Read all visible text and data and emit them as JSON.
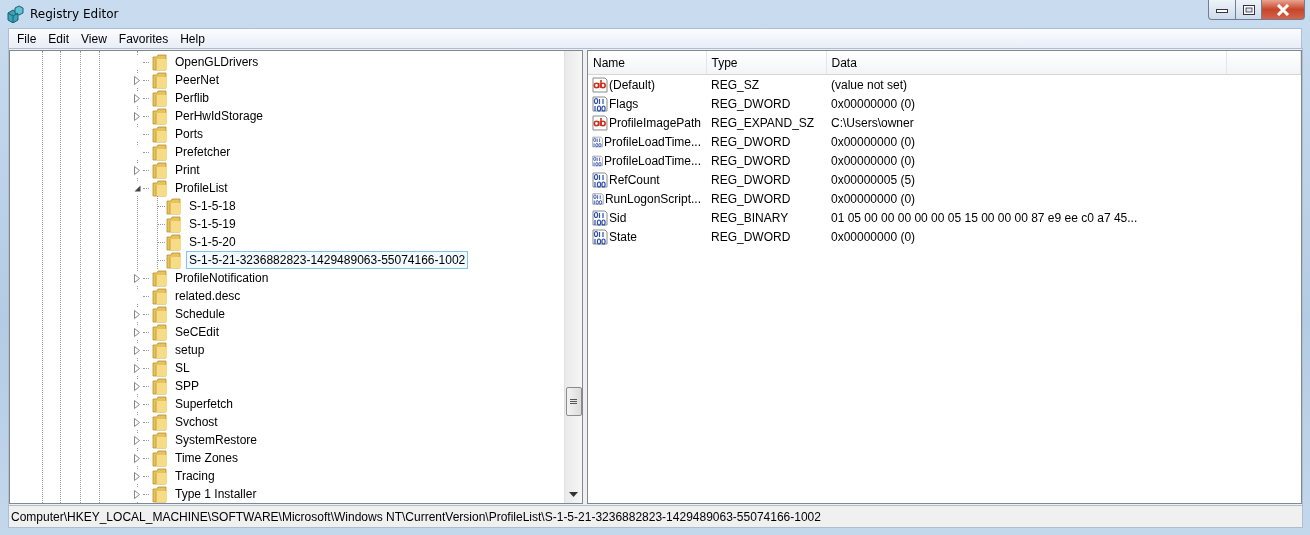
{
  "window": {
    "title": "Registry Editor"
  },
  "menu": [
    "File",
    "Edit",
    "View",
    "Favorites",
    "Help"
  ],
  "tree": {
    "items": [
      {
        "label": "OpenGLDrivers",
        "expandable": false,
        "selected": false
      },
      {
        "label": "PeerNet",
        "expandable": true,
        "expanded": false,
        "selected": false
      },
      {
        "label": "Perflib",
        "expandable": true,
        "expanded": false,
        "selected": false
      },
      {
        "label": "PerHwIdStorage",
        "expandable": true,
        "expanded": false,
        "selected": false
      },
      {
        "label": "Ports",
        "expandable": false,
        "selected": false
      },
      {
        "label": "Prefetcher",
        "expandable": false,
        "selected": false
      },
      {
        "label": "Print",
        "expandable": true,
        "expanded": false,
        "selected": false
      },
      {
        "label": "ProfileList",
        "expandable": true,
        "expanded": true,
        "selected": false,
        "children": [
          {
            "label": "S-1-5-18",
            "selected": false
          },
          {
            "label": "S-1-5-19",
            "selected": false
          },
          {
            "label": "S-1-5-20",
            "selected": false
          },
          {
            "label": "S-1-5-21-3236882823-1429489063-55074166-1002",
            "selected": true
          }
        ]
      },
      {
        "label": "ProfileNotification",
        "expandable": true,
        "expanded": false,
        "selected": false
      },
      {
        "label": "related.desc",
        "expandable": false,
        "selected": false
      },
      {
        "label": "Schedule",
        "expandable": true,
        "expanded": false,
        "selected": false
      },
      {
        "label": "SeCEdit",
        "expandable": true,
        "expanded": false,
        "selected": false
      },
      {
        "label": "setup",
        "expandable": true,
        "expanded": false,
        "selected": false
      },
      {
        "label": "SL",
        "expandable": true,
        "expanded": false,
        "selected": false
      },
      {
        "label": "SPP",
        "expandable": true,
        "expanded": false,
        "selected": false
      },
      {
        "label": "Superfetch",
        "expandable": true,
        "expanded": false,
        "selected": false
      },
      {
        "label": "Svchost",
        "expandable": true,
        "expanded": false,
        "selected": false
      },
      {
        "label": "SystemRestore",
        "expandable": true,
        "expanded": false,
        "selected": false
      },
      {
        "label": "Time Zones",
        "expandable": true,
        "expanded": false,
        "selected": false
      },
      {
        "label": "Tracing",
        "expandable": true,
        "expanded": false,
        "selected": false
      },
      {
        "label": "Type 1 Installer",
        "expandable": true,
        "expanded": false,
        "selected": false
      }
    ]
  },
  "values": {
    "columns": [
      "Name",
      "Type",
      "Data"
    ],
    "rows": [
      {
        "kind": "string",
        "name": "(Default)",
        "type": "REG_SZ",
        "data": "(value not set)"
      },
      {
        "kind": "binary",
        "name": "Flags",
        "type": "REG_DWORD",
        "data": "0x00000000 (0)"
      },
      {
        "kind": "string",
        "name": "ProfileImagePath",
        "type": "REG_EXPAND_SZ",
        "data": "C:\\Users\\owner"
      },
      {
        "kind": "binary",
        "name": "ProfileLoadTime...",
        "type": "REG_DWORD",
        "data": "0x00000000 (0)"
      },
      {
        "kind": "binary",
        "name": "ProfileLoadTime...",
        "type": "REG_DWORD",
        "data": "0x00000000 (0)"
      },
      {
        "kind": "binary",
        "name": "RefCount",
        "type": "REG_DWORD",
        "data": "0x00000005 (5)"
      },
      {
        "kind": "binary",
        "name": "RunLogonScript...",
        "type": "REG_DWORD",
        "data": "0x00000000 (0)"
      },
      {
        "kind": "binary",
        "name": "Sid",
        "type": "REG_BINARY",
        "data": "01 05 00 00 00 00 00 05 15 00 00 00 87 e9 ee c0 a7 45..."
      },
      {
        "kind": "binary",
        "name": "State",
        "type": "REG_DWORD",
        "data": "0x00000000 (0)"
      }
    ]
  },
  "status_bar": "Computer\\HKEY_LOCAL_MACHINE\\SOFTWARE\\Microsoft\\Windows NT\\CurrentVersion\\ProfileList\\S-1-5-21-3236882823-1429489063-55074166-1002"
}
